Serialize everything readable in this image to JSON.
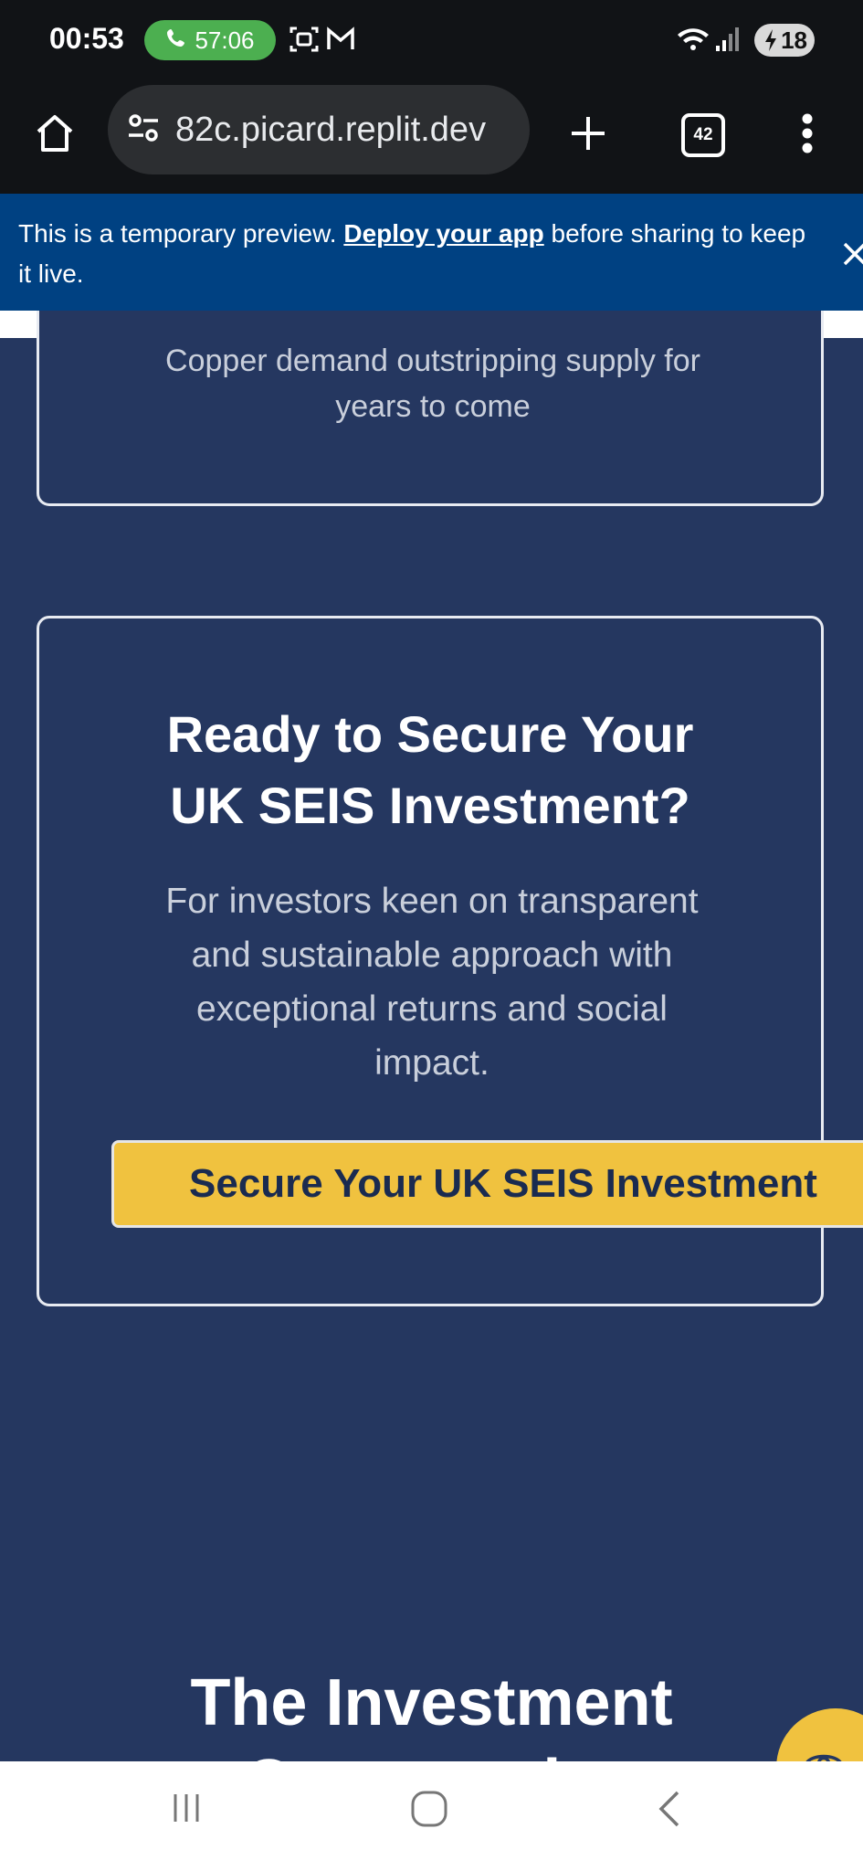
{
  "status_bar": {
    "time": "00:53",
    "call_duration": "57:06",
    "battery": "18"
  },
  "browser": {
    "url": "82c.picard.replit.dev",
    "tab_count": "42"
  },
  "banner": {
    "text_before": "This is a temporary preview. ",
    "link": "Deploy your app",
    "text_after": " before sharing to keep it live."
  },
  "page": {
    "card_top_text": "Copper demand outstripping supply for years to come",
    "cta_title": "Ready to Secure Your UK SEIS Investment?",
    "cta_body": "For investors keen on transparent and sustainable approach with exceptional returns and social impact.",
    "cta_button": "Secure Your UK SEIS Investment",
    "section_heading": "The Investment Opportunity"
  },
  "colors": {
    "page_bg": "#253760",
    "accent": "#f0c23f",
    "banner_bg": "#004182"
  }
}
